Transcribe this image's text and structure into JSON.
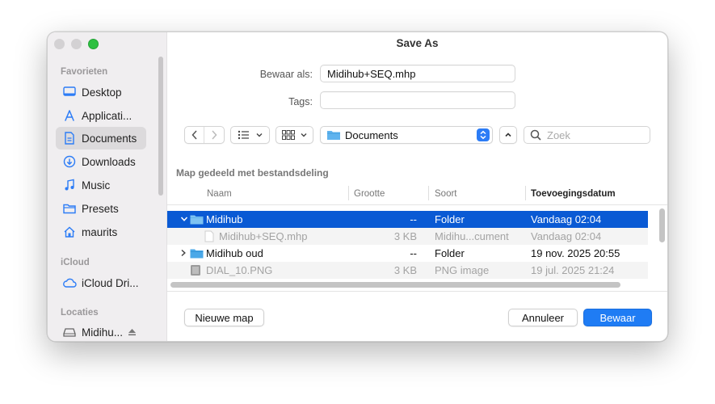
{
  "window": {
    "title": "Save As"
  },
  "sidebar": {
    "sections": [
      {
        "label": "Favorieten"
      },
      {
        "label": "iCloud"
      },
      {
        "label": "Locaties"
      }
    ],
    "favorites": [
      {
        "label": "Desktop",
        "icon": "desktop-icon"
      },
      {
        "label": "Applicati...",
        "icon": "applications-icon"
      },
      {
        "label": "Documents",
        "icon": "document-icon",
        "selected": true
      },
      {
        "label": "Downloads",
        "icon": "download-icon"
      },
      {
        "label": "Music",
        "icon": "music-icon"
      },
      {
        "label": "Presets",
        "icon": "folder-icon"
      },
      {
        "label": "maurits",
        "icon": "home-icon"
      }
    ],
    "icloud": [
      {
        "label": "iCloud Dri...",
        "icon": "cloud-icon"
      }
    ],
    "locations": [
      {
        "label": "Midihu...",
        "icon": "drive-icon",
        "eject": "eject-icon"
      }
    ]
  },
  "form": {
    "save_as_label": "Bewaar als:",
    "save_as_value": "Midihub+SEQ.mhp",
    "tags_label": "Tags:",
    "tags_value": ""
  },
  "toolbar": {
    "location": "Documents",
    "search_placeholder": "Zoek"
  },
  "browser": {
    "shared_label": "Map gedeeld met bestandsdeling",
    "columns": [
      "Naam",
      "Grootte",
      "Soort",
      "Toevoegingsdatum"
    ],
    "rows": [
      {
        "name": "Midihub",
        "size": "--",
        "kind": "Folder",
        "date": "Vandaag 02:04"
      },
      {
        "name": "Midihub+SEQ.mhp",
        "size": "3 KB",
        "kind": "Midihu...cument",
        "date": "Vandaag 02:04"
      },
      {
        "name": "Midihub oud",
        "size": "--",
        "kind": "Folder",
        "date": "19 nov. 2025 20:55"
      },
      {
        "name": "DIAL_10.PNG",
        "size": "3 KB",
        "kind": "PNG image",
        "date": "19 jul. 2025 21:24"
      }
    ]
  },
  "buttons": {
    "new_folder": "Nieuwe map",
    "cancel": "Annuleer",
    "save": "Bewaar"
  },
  "colors": {
    "accent": "#1f7cf4",
    "selection": "#0a5ad4",
    "folder": "#4aa8e8"
  }
}
